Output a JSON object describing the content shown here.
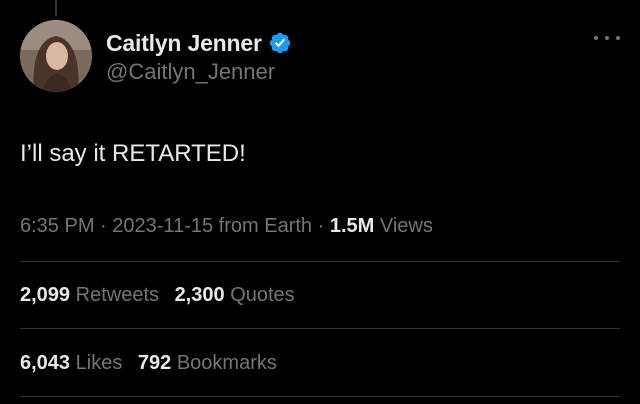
{
  "tweet": {
    "author": {
      "display_name": "Caitlyn Jenner",
      "handle": "@Caitlyn_Jenner",
      "verified": true
    },
    "text": "I’ll say it RETARTED!",
    "meta": {
      "time": "6:35 PM",
      "date": "2023-11-15",
      "source": "from Earth",
      "separator": "·",
      "views_count": "1.5M",
      "views_label": "Views"
    },
    "stats": {
      "retweets_count": "2,099",
      "retweets_label": "Retweets",
      "quotes_count": "2,300",
      "quotes_label": "Quotes",
      "likes_count": "6,043",
      "likes_label": "Likes",
      "bookmarks_count": "792",
      "bookmarks_label": "Bookmarks"
    }
  },
  "icons": {
    "verified": "verified-badge-icon",
    "more": "more-options-icon"
  },
  "colors": {
    "background": "#000000",
    "primary_text": "#e7e9ea",
    "secondary_text": "#71767b",
    "verified_blue": "#1d9bf0",
    "divider": "#2f3336"
  }
}
